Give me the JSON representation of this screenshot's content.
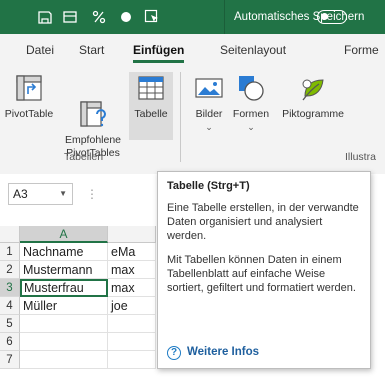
{
  "titlebar": {
    "autosave_label": "Automatisches Speichern",
    "icons": [
      "save-icon",
      "table-style-icon",
      "percent-icon",
      "record-icon",
      "cursor-select-icon"
    ]
  },
  "tabs": [
    {
      "label": "Datei"
    },
    {
      "label": "Start"
    },
    {
      "label": "Einfügen",
      "active": true
    },
    {
      "label": "Seitenlayout"
    },
    {
      "label": "Forme"
    }
  ],
  "ribbon": {
    "buttons": [
      {
        "label": "PivotTable"
      },
      {
        "label": "Empfohlene\nPivotTables"
      },
      {
        "label": "Tabelle",
        "selected": true
      },
      {
        "label": "Bilder"
      },
      {
        "label": "Formen"
      },
      {
        "label": "Piktogramme"
      }
    ],
    "groups": {
      "tabellen": "Tabellen",
      "illustrationen": "Illustra"
    }
  },
  "namebox": {
    "value": "A3"
  },
  "sheet": {
    "columns": [
      "A"
    ],
    "rows": [
      {
        "num": "1",
        "a": "Nachname",
        "b": "eMa"
      },
      {
        "num": "2",
        "a": "Mustermann",
        "b": "max"
      },
      {
        "num": "3",
        "a": "Musterfrau",
        "b": "max"
      },
      {
        "num": "4",
        "a": "Müller",
        "b": "joe"
      },
      {
        "num": "5",
        "a": "",
        "b": ""
      },
      {
        "num": "6",
        "a": "",
        "b": ""
      },
      {
        "num": "7",
        "a": "",
        "b": ""
      }
    ]
  },
  "tooltip": {
    "title": "Tabelle (Strg+T)",
    "p1": "Eine Tabelle erstellen, in der verwandte Daten organisiert und analysiert werden.",
    "p2": "Mit Tabellen können Daten in einem Tabellenblatt auf einfache Weise sortiert, gefiltert und formatiert werden.",
    "link": "Weitere Infos"
  },
  "colors": {
    "brand_green": "#217346",
    "link_blue": "#1e5f9e"
  }
}
